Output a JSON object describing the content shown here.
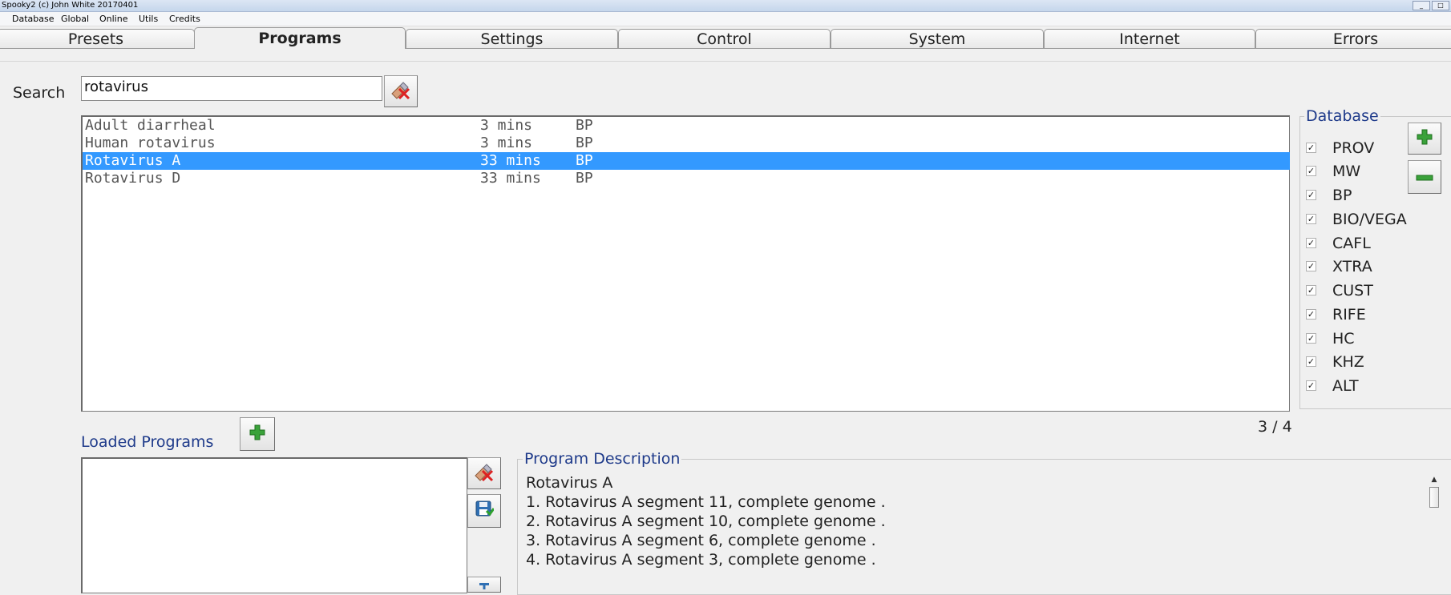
{
  "window": {
    "title": "Spooky2 (c) John White 20170401",
    "buttons": [
      "_",
      "□"
    ]
  },
  "menu": [
    "Database",
    "Global",
    "Online",
    "Utils",
    "Credits"
  ],
  "tabs": [
    {
      "label": "Presets"
    },
    {
      "label": "Programs",
      "active": true
    },
    {
      "label": "Settings"
    },
    {
      "label": "Control"
    },
    {
      "label": "System"
    },
    {
      "label": "Internet"
    },
    {
      "label": "Errors"
    }
  ],
  "search": {
    "label": "Search",
    "value": "rotavirus",
    "clear_icon": "eraser-icon"
  },
  "programs": {
    "rows": [
      {
        "name": "Adult diarrheal",
        "duration": "3 mins",
        "db": "BP",
        "selected": false
      },
      {
        "name": "Human rotavirus",
        "duration": "3 mins",
        "db": "BP",
        "selected": false
      },
      {
        "name": "Rotavirus A",
        "duration": "33 mins",
        "db": "BP",
        "selected": true
      },
      {
        "name": "Rotavirus D",
        "duration": "33 mins",
        "db": "BP",
        "selected": false
      }
    ],
    "count": "3 / 4"
  },
  "database": {
    "legend": "Database",
    "items": [
      {
        "label": "PROV",
        "checked": true
      },
      {
        "label": "MW",
        "checked": true
      },
      {
        "label": "BP",
        "checked": true
      },
      {
        "label": "BIO/VEGA",
        "checked": true
      },
      {
        "label": "CAFL",
        "checked": true
      },
      {
        "label": "XTRA",
        "checked": true
      },
      {
        "label": "CUST",
        "checked": true
      },
      {
        "label": "RIFE",
        "checked": true
      },
      {
        "label": "HC",
        "checked": true
      },
      {
        "label": "KHZ",
        "checked": true
      },
      {
        "label": "ALT",
        "checked": true
      }
    ],
    "add_icon": "plus-icon",
    "remove_icon": "minus-icon"
  },
  "loaded": {
    "label": "Loaded Programs",
    "add_icon": "plus-icon",
    "clear_icon": "eraser-icon",
    "save_icon": "save-icon"
  },
  "description": {
    "legend": "Program Description",
    "lines": [
      "Rotavirus A",
      "1. Rotavirus A segment 11, complete genome .",
      "2. Rotavirus A segment 10, complete genome .",
      "3. Rotavirus A segment 6, complete genome .",
      "4. Rotavirus A segment 3, complete genome ."
    ]
  },
  "colors": {
    "selection": "#3399ff",
    "plus_green": "#3aa23a",
    "legend_blue": "#1e3a8a"
  }
}
